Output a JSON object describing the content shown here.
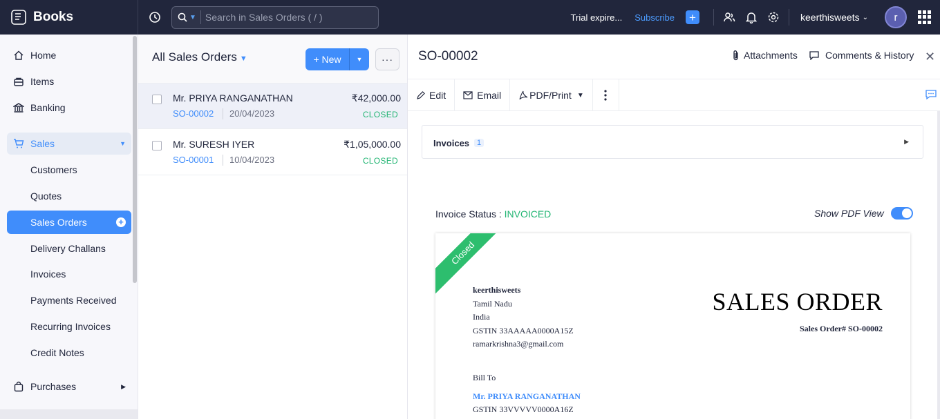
{
  "app": {
    "name": "Books"
  },
  "search": {
    "placeholder": "Search in Sales Orders ( / )"
  },
  "topbar": {
    "trial": "Trial expire...",
    "subscribe": "Subscribe",
    "org": "keerthisweets",
    "avatar_initial": "r"
  },
  "sidebar": {
    "home": "Home",
    "items": "Items",
    "banking": "Banking",
    "sales": "Sales",
    "customers": "Customers",
    "quotes": "Quotes",
    "sales_orders": "Sales Orders",
    "delivery_challans": "Delivery Challans",
    "invoices": "Invoices",
    "payments_received": "Payments Received",
    "recurring_invoices": "Recurring Invoices",
    "credit_notes": "Credit Notes",
    "purchases": "Purchases"
  },
  "list": {
    "title": "All Sales Orders",
    "new_label": "New",
    "rows": [
      {
        "customer": "Mr. PRIYA RANGANATHAN",
        "so": "SO-00002",
        "date": "20/04/2023",
        "amount": "₹42,000.00",
        "status": "CLOSED"
      },
      {
        "customer": "Mr. SURESH IYER",
        "so": "SO-00001",
        "date": "10/04/2023",
        "amount": "₹1,05,000.00",
        "status": "CLOSED"
      }
    ]
  },
  "detail": {
    "title": "SO-00002",
    "attachments": "Attachments",
    "comments": "Comments & History",
    "toolbar": {
      "edit": "Edit",
      "email": "Email",
      "pdf": "PDF/Print"
    },
    "invoices_label": "Invoices",
    "invoices_count": "1",
    "invoice_status_label": "Invoice Status : ",
    "invoice_status_value": "INVOICED",
    "show_pdf": "Show PDF View"
  },
  "paper": {
    "ribbon": "Closed",
    "org_name": "keerthisweets",
    "state": "Tamil Nadu",
    "country": "India",
    "gstin": "GSTIN 33AAAAA0000A15Z",
    "email": "ramarkrishna3@gmail.com",
    "doc_title": "SALES ORDER",
    "doc_number": "Sales Order# SO-00002",
    "bill_to": "Bill To",
    "bill_name": "Mr. PRIYA RANGANATHAN",
    "bill_gstin": "GSTIN 33VVVVV0000A16Z"
  },
  "colors": {
    "accent": "#408dfb",
    "topbar": "#21263c",
    "success": "#22b573"
  }
}
